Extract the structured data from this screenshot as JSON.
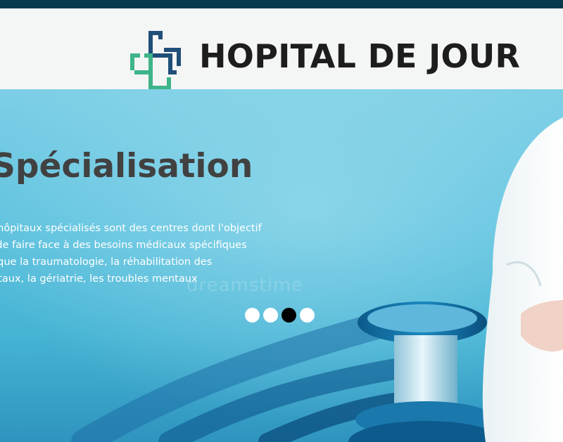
{
  "header": {
    "title": "HOPITAL DE JOUR",
    "logo_icon": "medical-cross-logo-icon",
    "colors": {
      "top_strip": "#063a4c",
      "logo_blue": "#1f4e79",
      "logo_green": "#3eb489"
    }
  },
  "slider": {
    "title": "Spécialisation",
    "text_lines": [
      "s hôpitaux spécialisés sont des centres dont l'objectif",
      "t de faire face à des besoins médicaux spécifiques",
      "s que la traumatologie, la réhabilitation des",
      "pitaux, la gériatrie, les troubles mentaux"
    ],
    "dots": [
      {
        "label": "Slide 1",
        "active": false
      },
      {
        "label": "Slide 2",
        "active": false
      },
      {
        "label": "Slide 3",
        "active": true
      },
      {
        "label": "Slide 4",
        "active": false
      }
    ],
    "watermark": "dreamstime"
  }
}
